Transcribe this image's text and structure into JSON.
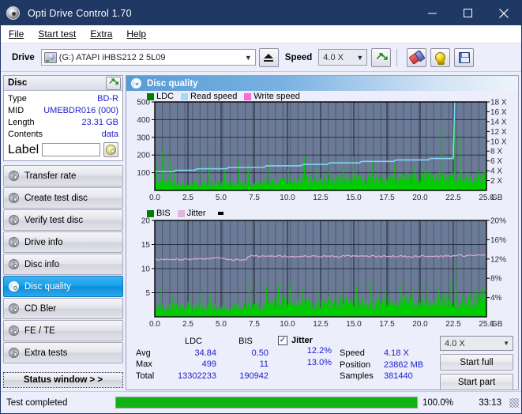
{
  "window": {
    "title": "Opti Drive Control 1.70",
    "icon": "disc-icon",
    "minimize": "minimize-icon",
    "maximize": "maximize-icon",
    "close": "close-icon"
  },
  "menu": [
    {
      "label": "File"
    },
    {
      "label": "Start test"
    },
    {
      "label": "Extra"
    },
    {
      "label": "Help"
    }
  ],
  "toolbar": {
    "drive_label": "Drive",
    "drive_value": "(G:)  ATAPI iHBS212  2 5L09",
    "eject": "eject-icon",
    "speed_label": "Speed",
    "speed_value": "4.0 X",
    "refresh": "refresh-icon",
    "erase": "erase-icon",
    "bulb": "bulb-icon",
    "save": "save-icon"
  },
  "disc": {
    "title": "Disc",
    "refresh": "refresh-icon",
    "rows": [
      {
        "key": "Type",
        "value": "BD-R"
      },
      {
        "key": "MID",
        "value": "UMEBDR016 (000)"
      },
      {
        "key": "Length",
        "value": "23.31 GB"
      },
      {
        "key": "Contents",
        "value": "data"
      }
    ],
    "label_key": "Label",
    "label_value": "",
    "label_btn": "cd-icon"
  },
  "sidebar": {
    "items": [
      {
        "label": "Transfer rate",
        "active": false
      },
      {
        "label": "Create test disc",
        "active": false
      },
      {
        "label": "Verify test disc",
        "active": false
      },
      {
        "label": "Drive info",
        "active": false
      },
      {
        "label": "Disc info",
        "active": false
      },
      {
        "label": "Disc quality",
        "active": true
      },
      {
        "label": "CD Bler",
        "active": false
      },
      {
        "label": "FE / TE",
        "active": false
      },
      {
        "label": "Extra tests",
        "active": false
      }
    ],
    "status_window": "Status window > >"
  },
  "main": {
    "title": "Disc quality",
    "icon": "disc-quality-icon"
  },
  "stats": {
    "col_headers": [
      "LDC",
      "BIS"
    ],
    "rows": [
      {
        "label": "Avg",
        "ldc": "34.84",
        "bis": "0.50"
      },
      {
        "label": "Max",
        "ldc": "499",
        "bis": "11"
      },
      {
        "label": "Total",
        "ldc": "13302233",
        "bis": "190942"
      }
    ],
    "jitter": {
      "checked": true,
      "label": "Jitter",
      "avg": "12.2%",
      "max": "13.0%"
    },
    "speed_key": "Speed",
    "speed_value": "4.18 X",
    "position_key": "Position",
    "position_value": "23862 MB",
    "samples_key": "Samples",
    "samples_value": "381440",
    "speed_select": "4.0 X",
    "start_full": "Start full",
    "start_part": "Start part"
  },
  "statusbar": {
    "message": "Test completed",
    "progress": 100,
    "percent": "100.0%",
    "elapsed": "33:13"
  },
  "colors": {
    "ldc": "#00cc00",
    "bis": "#00cc00",
    "read_speed": "#7fd8f7",
    "write_speed": "#ff66d8",
    "jitter": "#e0a8d8",
    "plot_bg": "#6b7a96",
    "accent": "#1f3864"
  },
  "chart_data": [
    {
      "type": "area",
      "name": "ldc-chart",
      "title": "",
      "xlabel": "GB",
      "ylabel": "",
      "xlim": [
        0,
        25.0
      ],
      "ylim": [
        0,
        500
      ],
      "y2lim": [
        0,
        18
      ],
      "y2label": "X",
      "xticks": [
        "0.0",
        "2.5",
        "5.0",
        "7.5",
        "10.0",
        "12.5",
        "15.0",
        "17.5",
        "20.0",
        "22.5",
        "25.0"
      ],
      "yticks": [
        "100",
        "200",
        "300",
        "400",
        "500"
      ],
      "y2ticks": [
        "2 X",
        "4 X",
        "6 X",
        "8 X",
        "10 X",
        "12 X",
        "14 X",
        "16 X",
        "18 X"
      ],
      "legend": [
        {
          "label": "LDC",
          "color": "#008000"
        },
        {
          "label": "Read speed",
          "color": "#7fd8f7"
        },
        {
          "label": "Write speed",
          "color": "#ff66d8"
        }
      ],
      "grid": true,
      "series": [
        {
          "name": "LDC",
          "color": "#00cc00",
          "kind": "area-noise",
          "base": [
            45,
            52,
            48,
            50,
            46,
            44,
            47,
            45,
            43,
            44,
            46,
            44,
            43,
            45,
            44,
            46,
            48,
            47,
            50,
            52,
            55,
            58,
            60,
            62,
            66,
            70,
            74,
            76,
            78,
            76,
            74,
            72,
            74,
            76,
            74,
            72,
            74,
            76,
            78,
            76,
            74,
            76,
            78,
            80,
            80,
            82,
            80,
            82,
            84,
            86,
            88,
            86,
            84,
            86,
            88,
            90,
            88,
            90,
            92,
            120
          ],
          "spikes": [
            {
              "x": 0.12,
              "y": 148
            },
            {
              "x": 0.55,
              "y": 250
            },
            {
              "x": 0.8,
              "y": 200
            },
            {
              "x": 1.15,
              "y": 196
            },
            {
              "x": 1.45,
              "y": 120
            },
            {
              "x": 3.55,
              "y": 205
            },
            {
              "x": 4.05,
              "y": 143
            },
            {
              "x": 5.25,
              "y": 120
            },
            {
              "x": 6.35,
              "y": 175
            },
            {
              "x": 7.05,
              "y": 130
            },
            {
              "x": 8.6,
              "y": 155
            },
            {
              "x": 10.0,
              "y": 125
            },
            {
              "x": 11.3,
              "y": 190
            },
            {
              "x": 12.25,
              "y": 140
            },
            {
              "x": 13.1,
              "y": 125
            },
            {
              "x": 14.2,
              "y": 185
            },
            {
              "x": 15.0,
              "y": 193
            },
            {
              "x": 16.4,
              "y": 160
            },
            {
              "x": 18.1,
              "y": 150
            },
            {
              "x": 19.6,
              "y": 138
            },
            {
              "x": 20.4,
              "y": 170
            },
            {
              "x": 21.6,
              "y": 400
            },
            {
              "x": 22.6,
              "y": 499
            },
            {
              "x": 23.1,
              "y": 300
            }
          ]
        },
        {
          "name": "Read speed",
          "color": "#7fd8f7",
          "kind": "step",
          "points": [
            {
              "x": 0.0,
              "y": 3.8
            },
            {
              "x": 1.4,
              "y": 3.8
            },
            {
              "x": 1.6,
              "y": 4.1
            },
            {
              "x": 3.0,
              "y": 4.1
            },
            {
              "x": 3.2,
              "y": 4.4
            },
            {
              "x": 5.4,
              "y": 4.4
            },
            {
              "x": 5.6,
              "y": 4.7
            },
            {
              "x": 8.2,
              "y": 4.7
            },
            {
              "x": 8.4,
              "y": 5.0
            },
            {
              "x": 11.0,
              "y": 5.0
            },
            {
              "x": 11.2,
              "y": 5.3
            },
            {
              "x": 13.0,
              "y": 5.3
            },
            {
              "x": 13.2,
              "y": 5.6
            },
            {
              "x": 15.4,
              "y": 5.6
            },
            {
              "x": 15.6,
              "y": 5.9
            },
            {
              "x": 18.0,
              "y": 5.9
            },
            {
              "x": 18.2,
              "y": 6.2
            },
            {
              "x": 20.6,
              "y": 6.2
            },
            {
              "x": 20.8,
              "y": 6.5
            },
            {
              "x": 22.5,
              "y": 6.5
            },
            {
              "x": 22.6,
              "y": 18.0
            },
            {
              "x": 22.7,
              "y": 18.0
            }
          ]
        }
      ]
    },
    {
      "type": "area",
      "name": "bis-chart",
      "title": "",
      "xlabel": "GB",
      "ylabel": "",
      "xlim": [
        0,
        25.0
      ],
      "ylim": [
        0,
        20
      ],
      "y2lim": [
        0,
        20
      ],
      "y2label": "%",
      "xticks": [
        "0.0",
        "2.5",
        "5.0",
        "7.5",
        "10.0",
        "12.5",
        "15.0",
        "17.5",
        "20.0",
        "22.5",
        "25.0"
      ],
      "yticks": [
        "5",
        "10",
        "15",
        "20"
      ],
      "y2ticks": [
        "4%",
        "8%",
        "12%",
        "16%",
        "20%"
      ],
      "legend": [
        {
          "label": "BIS",
          "color": "#008000"
        },
        {
          "label": "Jitter",
          "color": "#e0a8d8"
        }
      ],
      "grid": true,
      "series": [
        {
          "name": "BIS",
          "color": "#00cc00",
          "kind": "area-noise",
          "base": [
            2.4,
            2.6,
            2.2,
            2.5,
            2.3,
            2.1,
            2.4,
            2.2,
            2.0,
            2.2,
            2.3,
            2.1,
            2.0,
            2.2,
            2.1,
            2.3,
            2.4,
            2.3,
            2.5,
            2.6,
            3.4,
            3.6,
            3.5,
            3.7,
            3.6,
            3.5,
            3.7,
            3.6,
            3.4,
            3.6,
            3.7,
            3.5,
            3.6,
            3.8,
            3.6,
            3.5,
            3.7,
            3.6,
            3.8,
            3.6,
            3.5,
            3.7,
            3.6,
            3.8,
            3.7,
            3.6,
            3.8,
            3.7,
            3.6,
            3.8,
            3.7,
            3.9,
            3.8,
            3.7,
            3.9,
            3.8,
            4.0,
            4.2,
            4.6,
            7.0
          ],
          "spikes": [
            {
              "x": 0.5,
              "y": 6.0
            },
            {
              "x": 1.3,
              "y": 4.6
            },
            {
              "x": 2.6,
              "y": 4.8
            },
            {
              "x": 3.4,
              "y": 5.0
            },
            {
              "x": 4.2,
              "y": 4.7
            },
            {
              "x": 5.3,
              "y": 4.9
            },
            {
              "x": 6.2,
              "y": 5.0
            },
            {
              "x": 7.1,
              "y": 8.2
            },
            {
              "x": 7.6,
              "y": 6.6
            },
            {
              "x": 8.4,
              "y": 6.4
            },
            {
              "x": 9.3,
              "y": 7.0
            },
            {
              "x": 10.2,
              "y": 6.8
            },
            {
              "x": 11.1,
              "y": 6.2
            },
            {
              "x": 12.3,
              "y": 6.6
            },
            {
              "x": 13.2,
              "y": 6.2
            },
            {
              "x": 14.1,
              "y": 6.8
            },
            {
              "x": 15.2,
              "y": 6.4
            },
            {
              "x": 16.3,
              "y": 7.2
            },
            {
              "x": 17.4,
              "y": 6.4
            },
            {
              "x": 18.5,
              "y": 6.8
            },
            {
              "x": 19.4,
              "y": 6.2
            },
            {
              "x": 20.5,
              "y": 7.0
            },
            {
              "x": 21.4,
              "y": 6.6
            },
            {
              "x": 22.3,
              "y": 7.4
            },
            {
              "x": 22.7,
              "y": 11.0
            }
          ]
        },
        {
          "name": "Jitter",
          "color": "#e0a8d8",
          "kind": "line",
          "points": [
            {
              "x": 0.0,
              "y": 11.8
            },
            {
              "x": 0.6,
              "y": 11.9
            },
            {
              "x": 1.2,
              "y": 11.9
            },
            {
              "x": 1.9,
              "y": 12.0
            },
            {
              "x": 2.6,
              "y": 12.0
            },
            {
              "x": 3.3,
              "y": 12.1
            },
            {
              "x": 4.0,
              "y": 12.1
            },
            {
              "x": 4.6,
              "y": 12.2
            },
            {
              "x": 5.1,
              "y": 12.3
            },
            {
              "x": 5.5,
              "y": 12.0
            },
            {
              "x": 5.9,
              "y": 11.8
            },
            {
              "x": 6.4,
              "y": 11.8
            },
            {
              "x": 6.8,
              "y": 11.7
            },
            {
              "x": 7.0,
              "y": 12.5
            },
            {
              "x": 7.4,
              "y": 12.7
            },
            {
              "x": 7.9,
              "y": 12.6
            },
            {
              "x": 8.6,
              "y": 12.5
            },
            {
              "x": 9.4,
              "y": 12.6
            },
            {
              "x": 10.2,
              "y": 12.5
            },
            {
              "x": 11.0,
              "y": 12.6
            },
            {
              "x": 11.9,
              "y": 12.5
            },
            {
              "x": 12.8,
              "y": 12.6
            },
            {
              "x": 13.7,
              "y": 12.5
            },
            {
              "x": 14.6,
              "y": 12.6
            },
            {
              "x": 15.5,
              "y": 12.5
            },
            {
              "x": 16.4,
              "y": 12.6
            },
            {
              "x": 17.3,
              "y": 12.5
            },
            {
              "x": 18.2,
              "y": 12.6
            },
            {
              "x": 19.1,
              "y": 12.5
            },
            {
              "x": 20.0,
              "y": 12.6
            },
            {
              "x": 21.0,
              "y": 12.5
            },
            {
              "x": 22.0,
              "y": 12.6
            },
            {
              "x": 22.6,
              "y": 12.7
            }
          ]
        }
      ]
    }
  ]
}
